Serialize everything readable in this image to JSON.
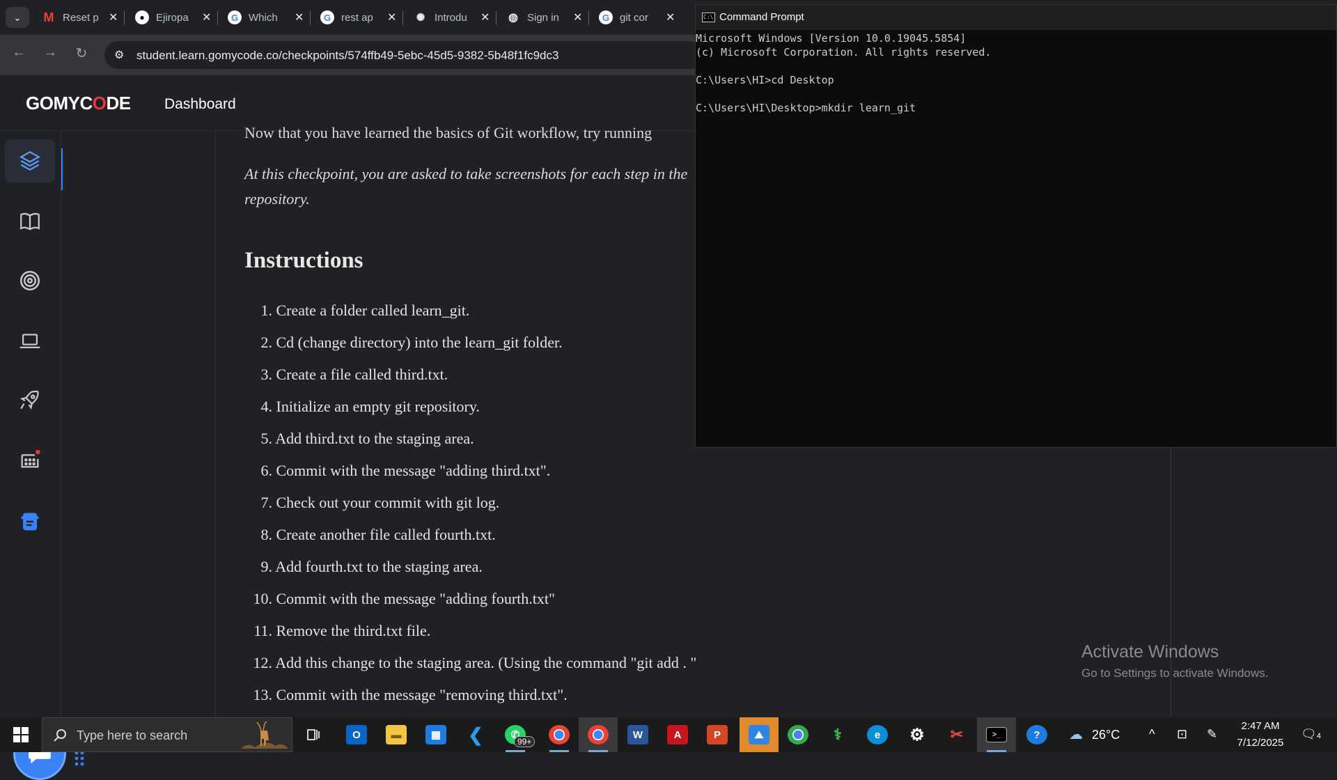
{
  "browser": {
    "tabs": [
      {
        "title": "Reset p",
        "icon": "gmail-icon"
      },
      {
        "title": "Ejiropa",
        "icon": "github-icon"
      },
      {
        "title": "Which",
        "icon": "google-icon"
      },
      {
        "title": "rest ap",
        "icon": "google-icon"
      },
      {
        "title": "Introdu",
        "icon": "openai-icon"
      },
      {
        "title": "Sign in",
        "icon": "globe-icon"
      },
      {
        "title": "git cor",
        "icon": "google-icon"
      }
    ],
    "url": "student.learn.gomycode.co/checkpoints/574ffb49-5ebc-45d5-9382-5b48f1fc9dc3"
  },
  "site": {
    "logo_pre": "GOMYC",
    "logo_o": "O",
    "logo_post": "DE",
    "nav_dashboard": "Dashboard"
  },
  "content": {
    "intro_line": "Now that you have learned the basics of Git workflow, try running",
    "intro_italic": "At this checkpoint, you are asked to take screenshots for each step in the",
    "intro_italic_2": "repository.",
    "heading": "Instructions",
    "steps": [
      {
        "num": "1.",
        "text": "Create a folder called learn_git."
      },
      {
        "num": "2.",
        "text": "Cd (change directory) into the learn_git folder."
      },
      {
        "num": "3.",
        "text": "Create a file called third.txt."
      },
      {
        "num": "4.",
        "text": "Initialize an empty git repository."
      },
      {
        "num": "5.",
        "text": "Add third.txt to the staging area."
      },
      {
        "num": "6.",
        "text": "Commit with the message \"adding third.txt\"."
      },
      {
        "num": "7.",
        "text": "Check out your commit with git log."
      },
      {
        "num": "8.",
        "text": "Create another file called fourth.txt."
      },
      {
        "num": "9.",
        "text": "Add fourth.txt to the staging area."
      },
      {
        "num": "10.",
        "text": "Commit with the message \"adding fourth.txt\""
      },
      {
        "num": "11.",
        "text": "Remove the third.txt file."
      },
      {
        "num": "12.",
        "text": "Add this change to the staging area. (Using the command \"git add . \""
      },
      {
        "num": "13.",
        "text": "Commit with the message \"removing third.txt\"."
      }
    ]
  },
  "watermark": {
    "line1": "Activate Windows",
    "line2": "Go to Settings to activate Windows."
  },
  "cmd": {
    "title": "Command Prompt",
    "lines": "Microsoft Windows [Version 10.0.19045.5854]\n(c) Microsoft Corporation. All rights reserved.\n\nC:\\Users\\HI>cd Desktop\n\nC:\\Users\\HI\\Desktop>mkdir learn_git"
  },
  "taskbar": {
    "search_placeholder": "Type here to search",
    "whatsapp_badge": "99+",
    "temperature": "26°C",
    "time": "2:47 AM",
    "date": "7/12/2025",
    "notification_count": "4"
  },
  "colors": {
    "accent": "#3b82f6",
    "logo_red": "#e8343f"
  }
}
